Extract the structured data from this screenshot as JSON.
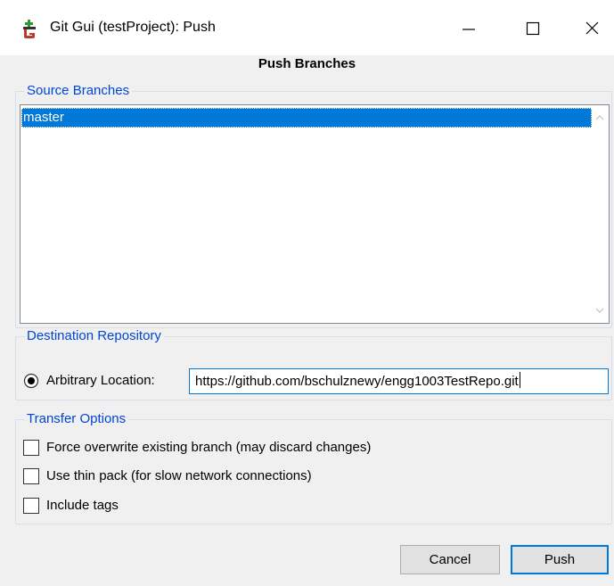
{
  "window": {
    "title": "Git Gui (testProject): Push"
  },
  "header": {
    "title": "Push Branches"
  },
  "source_branches": {
    "label": "Source Branches",
    "items": [
      {
        "label": "master",
        "selected": true
      }
    ]
  },
  "destination": {
    "label": "Destination Repository",
    "option_label": "Arbitrary Location:",
    "selected": true,
    "url": "https://github.com/bschulznewy/engg1003TestRepo.git"
  },
  "transfer_options": {
    "label": "Transfer Options",
    "options": [
      {
        "label": "Force overwrite existing branch (may discard changes)",
        "checked": false
      },
      {
        "label": "Use thin pack (for slow network connections)",
        "checked": false
      },
      {
        "label": "Include tags",
        "checked": false
      }
    ]
  },
  "buttons": {
    "cancel": "Cancel",
    "push": "Push"
  },
  "colors": {
    "accent": "#0078d7",
    "group_label": "#0046d5",
    "background": "#f0f0f0"
  }
}
